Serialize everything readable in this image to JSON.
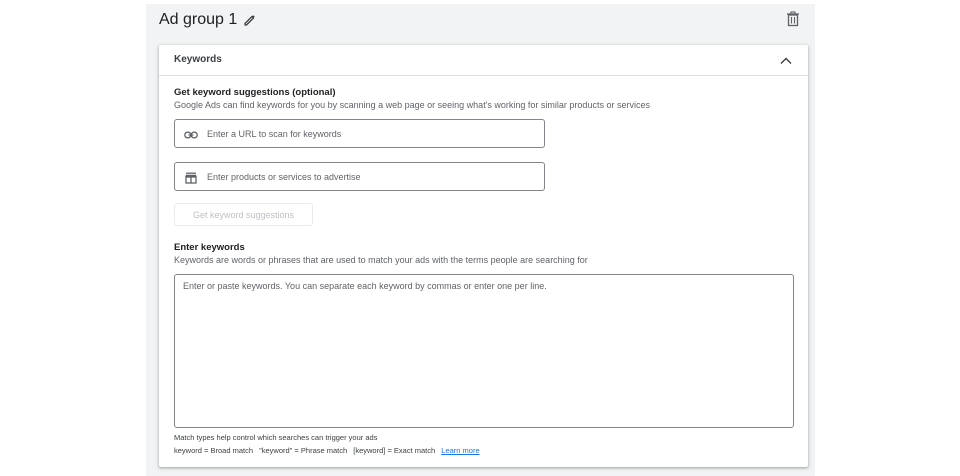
{
  "ad_group": {
    "title": "Ad group 1",
    "edit_icon": "pencil-icon",
    "delete_icon": "trash-icon"
  },
  "keywords_card": {
    "header": "Keywords",
    "collapse_icon": "chevron-up-icon",
    "suggestions": {
      "title": "Get keyword suggestions (optional)",
      "description": "Google Ads can find keywords for you by scanning a web page or seeing what's working for similar products or services",
      "url_field": {
        "icon": "link-icon",
        "placeholder": "Enter a URL to scan for keywords",
        "value": ""
      },
      "products_field": {
        "icon": "store-icon",
        "placeholder": "Enter products or services to advertise",
        "value": ""
      },
      "button_label": "Get keyword suggestions"
    },
    "enter_keywords": {
      "title": "Enter keywords",
      "description": "Keywords are words or phrases that are used to match your ads with the terms people are searching for",
      "textarea_placeholder": "Enter or paste keywords. You can separate each keyword by commas or enter one per line.",
      "textarea_value": ""
    },
    "match_types": {
      "note": "Match types help control which searches can trigger your ads",
      "broad": "keyword = Broad match",
      "phrase": "\"keyword\" = Phrase match",
      "exact": "[keyword] = Exact match",
      "learn_more": "Learn more"
    }
  },
  "colors": {
    "accent": "#1a73e8",
    "outer_bg": "#f1f3f4",
    "border": "#80868b"
  }
}
